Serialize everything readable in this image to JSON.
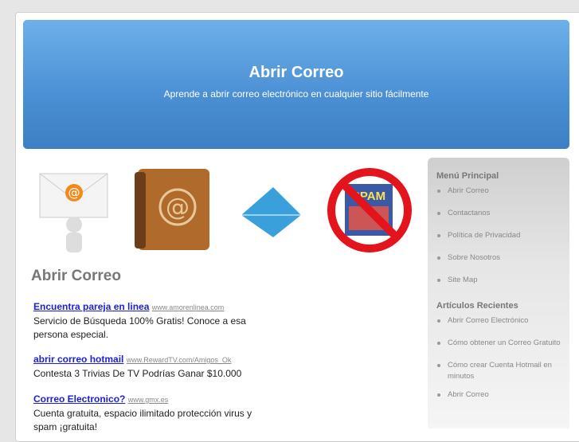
{
  "header": {
    "title": "Abrir Correo",
    "subtitle": "Aprende a abrir correo electrónico en cualquier sitio fácilmente"
  },
  "images": {
    "spam_label": "SPAM"
  },
  "main": {
    "heading": "Abrir Correo",
    "ads": [
      {
        "title": "Encuentra pareja en linea",
        "url": "www.amorenlinea.com",
        "text": "Servicio de Búsqueda 100% Gratis! Conoce a esa persona especial."
      },
      {
        "title": "abrir correo hotmail",
        "url": "www.RewardTV.com/Amigos_Ok",
        "text": "Contesta 3 Trivias De TV Podrías Ganar $10.000"
      },
      {
        "title": "Correo Electronico?",
        "url": "www.gmx.es",
        "text": "Cuenta gratuita, espacio ilimitado protección virus y spam ¡gratuita!"
      }
    ]
  },
  "sidebar": {
    "menu_title": "Menú Principal",
    "menu": [
      "Abrir Correo",
      "Contactanos",
      "Política de Privacidad",
      "Sobre Nosotros",
      "Site Map"
    ],
    "recent_title": "Artículos Recientes",
    "recent": [
      "Abrir Correo Electrónico",
      "Cómo obtener un Correo Gratuito",
      "Cómo crear Cuenta Hotmail en minutos",
      "Abrir Correo"
    ]
  }
}
